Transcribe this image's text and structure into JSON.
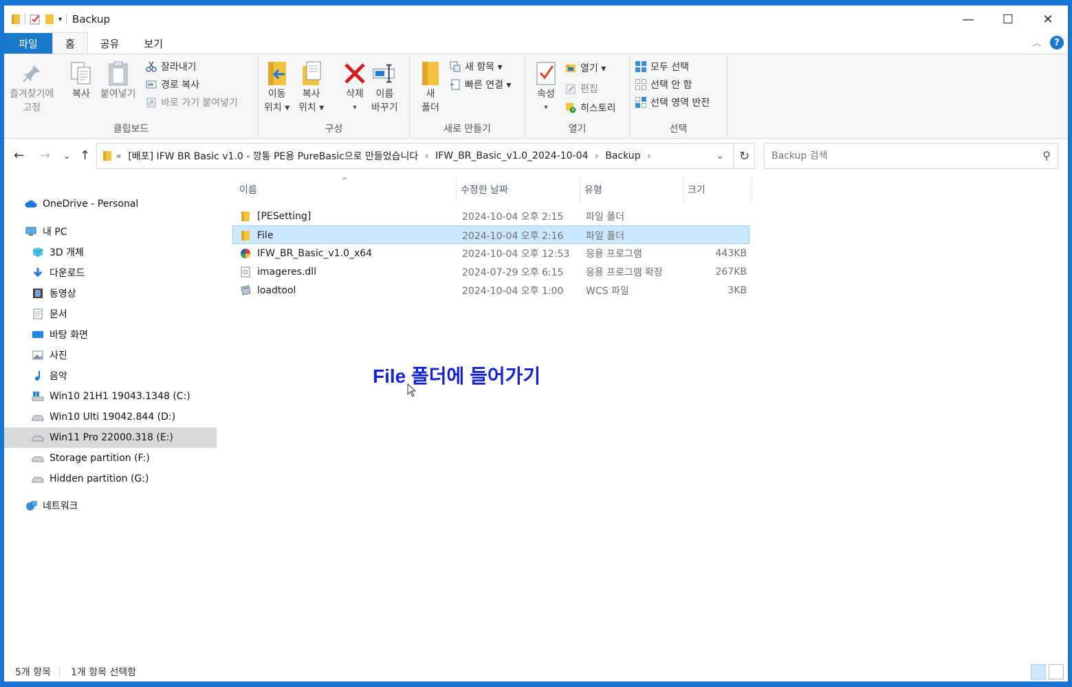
{
  "window": {
    "title": "Backup",
    "controls": {
      "minimize": "—",
      "maximize": "☐",
      "close": "✕"
    }
  },
  "ribbon": {
    "tabs": [
      {
        "label": "파일"
      },
      {
        "label": "홈"
      },
      {
        "label": "공유"
      },
      {
        "label": "보기"
      }
    ],
    "active_tab": "홈",
    "help": "?",
    "groups": {
      "clipboard": {
        "label": "클립보드",
        "pin": [
          "즐겨찾기에",
          "고정"
        ],
        "copy": "복사",
        "paste": "붙여넣기",
        "cut": "잘라내기",
        "copy_path": "경로 복사",
        "paste_shortcut": "바로 가기 붙여넣기"
      },
      "organize": {
        "label": "구성",
        "move_to": [
          "이동",
          "위치 ▾"
        ],
        "copy_to": [
          "복사",
          "위치 ▾"
        ],
        "delete": [
          "삭제",
          "▾"
        ],
        "rename": [
          "이름",
          "바꾸기"
        ]
      },
      "new": {
        "label": "새로 만들기",
        "new_folder": [
          "새",
          "폴더"
        ],
        "new_item": "새 항목 ▾",
        "easy_access": "빠른 연결 ▾"
      },
      "open": {
        "label": "열기",
        "properties": [
          "속성",
          "▾"
        ],
        "open": "열기 ▾",
        "edit": "편집",
        "history": "히스토리"
      },
      "select": {
        "label": "선택",
        "select_all": "모두 선택",
        "select_none": "선택 안 함",
        "invert": "선택 영역 반전"
      }
    }
  },
  "address": {
    "overflow": "«",
    "crumbs": [
      "[배포] IFW BR Basic v1.0 - 깡통 PE용 PureBasic으로 만들었습니다",
      "IFW_BR_Basic_v1.0_2024-10-04",
      "Backup"
    ],
    "search_placeholder": "Backup 검색"
  },
  "sidebar": {
    "items": [
      {
        "label": "OneDrive - Personal",
        "icon": "cloud-icon"
      },
      {
        "label": "내 PC",
        "icon": "computer-icon"
      },
      {
        "label": "3D 개체",
        "icon": "cube-icon"
      },
      {
        "label": "다운로드",
        "icon": "download-icon"
      },
      {
        "label": "동영상",
        "icon": "film-icon"
      },
      {
        "label": "문서",
        "icon": "document-icon"
      },
      {
        "label": "바탕 화면",
        "icon": "desktop-icon"
      },
      {
        "label": "사진",
        "icon": "picture-icon"
      },
      {
        "label": "음악",
        "icon": "music-icon"
      },
      {
        "label": "Win10 21H1 19043.1348 (C:)",
        "icon": "system-drive-icon"
      },
      {
        "label": "Win10 Ulti 19042.844 (D:)",
        "icon": "drive-icon"
      },
      {
        "label": "Win11 Pro 22000.318 (E:)",
        "icon": "drive-icon",
        "selected": true
      },
      {
        "label": "Storage partition (F:)",
        "icon": "drive-icon"
      },
      {
        "label": "Hidden partition (G:)",
        "icon": "drive-icon"
      },
      {
        "label": "네트워크",
        "icon": "network-icon"
      }
    ]
  },
  "filelist": {
    "columns": [
      "이름",
      "수정한 날짜",
      "유형",
      "크기"
    ],
    "sort_indicator": "^",
    "rows": [
      {
        "name": "[PESetting]",
        "date": "2024-10-04 오후 2:15",
        "type": "파일 폴더",
        "size": "",
        "icon": "folder-icon"
      },
      {
        "name": "File",
        "date": "2024-10-04 오후 2:16",
        "type": "파일 폴더",
        "size": "",
        "icon": "folder-icon",
        "selected": true
      },
      {
        "name": "IFW_BR_Basic_v1.0_x64",
        "date": "2024-10-04 오후 12:53",
        "type": "응용 프로그램",
        "size": "443KB",
        "icon": "app-icon"
      },
      {
        "name": "imageres.dll",
        "date": "2024-07-29 오후 6:15",
        "type": "응용 프로그램 확장",
        "size": "267KB",
        "icon": "dll-icon"
      },
      {
        "name": "loadtool",
        "date": "2024-10-04 오후 1:00",
        "type": "WCS 파일",
        "size": "3KB",
        "icon": "wcs-file-icon"
      }
    ]
  },
  "annotation": "File 폴더에 들어가기",
  "status": {
    "count": "5개 항목",
    "selected": "1개 항목 선택함"
  },
  "colors": {
    "accent": "#1979ca",
    "selection": "#cce8ff",
    "annotation": "#1422d6"
  }
}
